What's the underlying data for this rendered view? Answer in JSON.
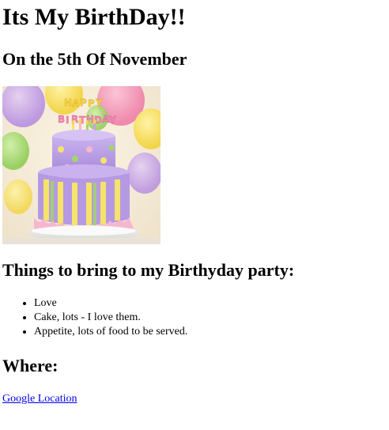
{
  "header": {
    "title": "Its My BirthDay!!",
    "subtitle": "On the 5th Of November"
  },
  "image": {
    "icon": "birthday-cake-photo",
    "banner_text": "HAPPY BIRTHDAY",
    "colors": {
      "balloon_yellow": "#f6e06a",
      "balloon_pink": "#f38fb4",
      "balloon_green": "#9fd86a",
      "balloon_purple": "#c9a0e8",
      "cake_purple": "#b79be0",
      "cake_yellow_stripe": "#f5e36a",
      "cake_pink": "#f7b6cf"
    }
  },
  "things": {
    "heading": "Things to bring to my Birthyday party:",
    "items": [
      "Love",
      "Cake, lots - I love them.",
      "Appetite, lots of food to be served."
    ]
  },
  "where": {
    "heading": "Where:",
    "link_label": "Google Location"
  },
  "colors": {
    "link": "#0000ee",
    "text": "#000000",
    "background": "#ffffff"
  }
}
